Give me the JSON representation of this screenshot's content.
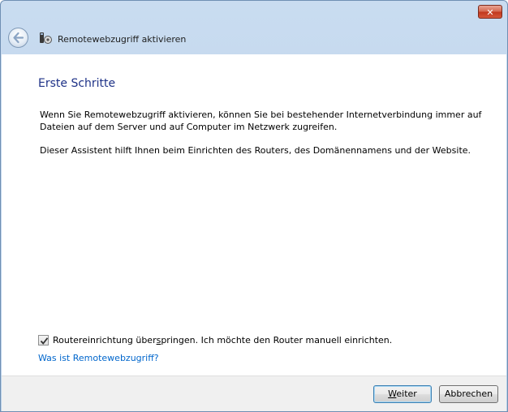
{
  "window": {
    "close_label": "✕"
  },
  "navbar": {
    "title": "Remotewebzugriff aktivieren"
  },
  "main": {
    "heading": "Erste Schritte",
    "paragraph1": "Wenn Sie Remotewebzugriff aktivieren, können Sie bei bestehender Internetverbindung immer auf Dateien auf dem Server und auf Computer im Netzwerk zugreifen.",
    "paragraph2": "Dieser Assistent hilft Ihnen beim Einrichten des Routers, des Domänennamens und der Website.",
    "skip_router_checkbox": {
      "checked": true,
      "label_before": "Routereinrichtung über",
      "label_accel": "s",
      "label_after": "pringen. Ich möchte den Router manuell einrichten."
    },
    "help_link": "Was ist Remotewebzugriff?"
  },
  "footer": {
    "next_accel": "W",
    "next_rest": "eiter",
    "cancel_label": "Abbrechen"
  },
  "icons": {
    "back": "back-arrow-icon",
    "app": "remote-access-icon",
    "check": "checkmark-icon"
  }
}
